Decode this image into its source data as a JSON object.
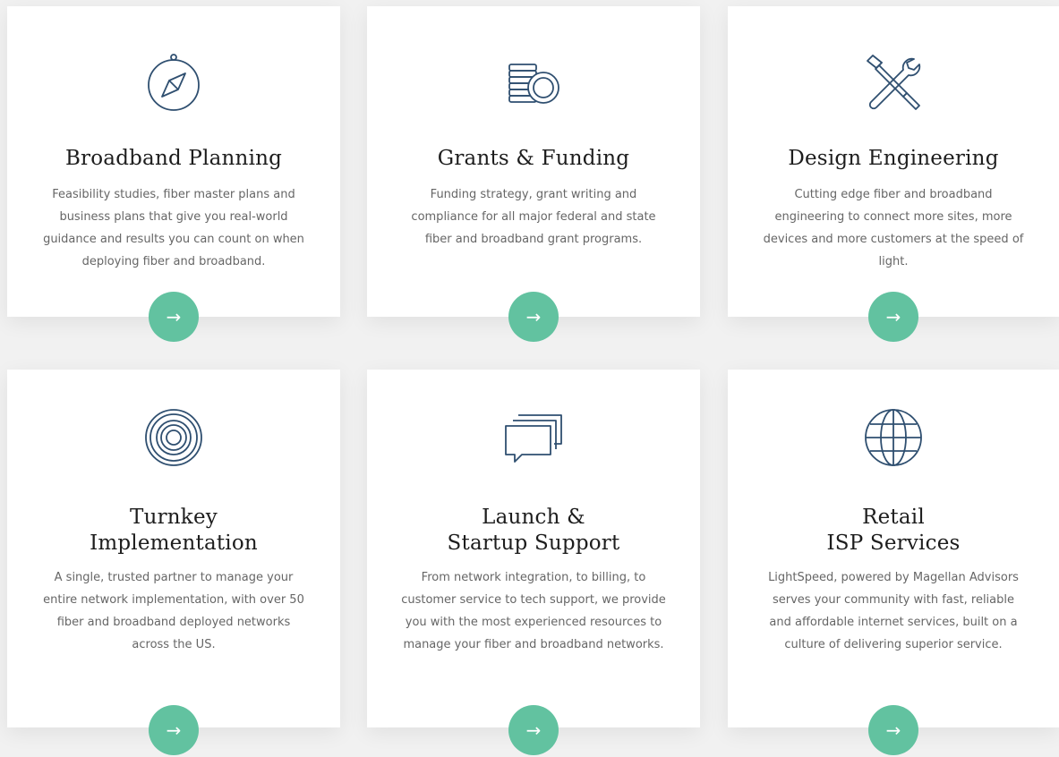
{
  "colors": {
    "accent": "#62c2a0",
    "icon": "#2f4f70",
    "background": "#f1f1f1"
  },
  "cards": [
    {
      "icon": "compass-icon",
      "title": "Broadband Planning",
      "description": "Feasibility studies, fiber master plans and business plans that give you real-world guidance and results you can count on when deploying fiber and broadband.",
      "button": "→"
    },
    {
      "icon": "coins-icon",
      "title": "Grants & Funding",
      "description": "Funding strategy, grant writing and compliance for all major federal and state fiber and broadband grant programs.",
      "button": "→"
    },
    {
      "icon": "tools-icon",
      "title": "Design Engineering",
      "description": "Cutting edge fiber and broadband engineering to connect more sites, more devices and more customers at the speed of light.",
      "button": "→"
    },
    {
      "icon": "target-icon",
      "title_line1": "Turnkey",
      "title_line2": "Implementation",
      "description": "A single, trusted partner to manage your entire network implementation, with over 50 fiber and broadband deployed networks across the US.",
      "button": "→"
    },
    {
      "icon": "chat-bubbles-icon",
      "title_line1": "Launch &",
      "title_line2": "Startup Support",
      "description": "From network integration, to billing, to customer service to tech support, we provide you with the most experienced resources to manage your fiber and broadband networks.",
      "button": "→"
    },
    {
      "icon": "globe-icon",
      "title_line1": "Retail",
      "title_line2": "ISP Services",
      "description": "LightSpeed, powered by Magellan Advisors serves your community with fast, reliable and affordable internet services, built on a culture of delivering superior service.",
      "button": "→"
    }
  ]
}
